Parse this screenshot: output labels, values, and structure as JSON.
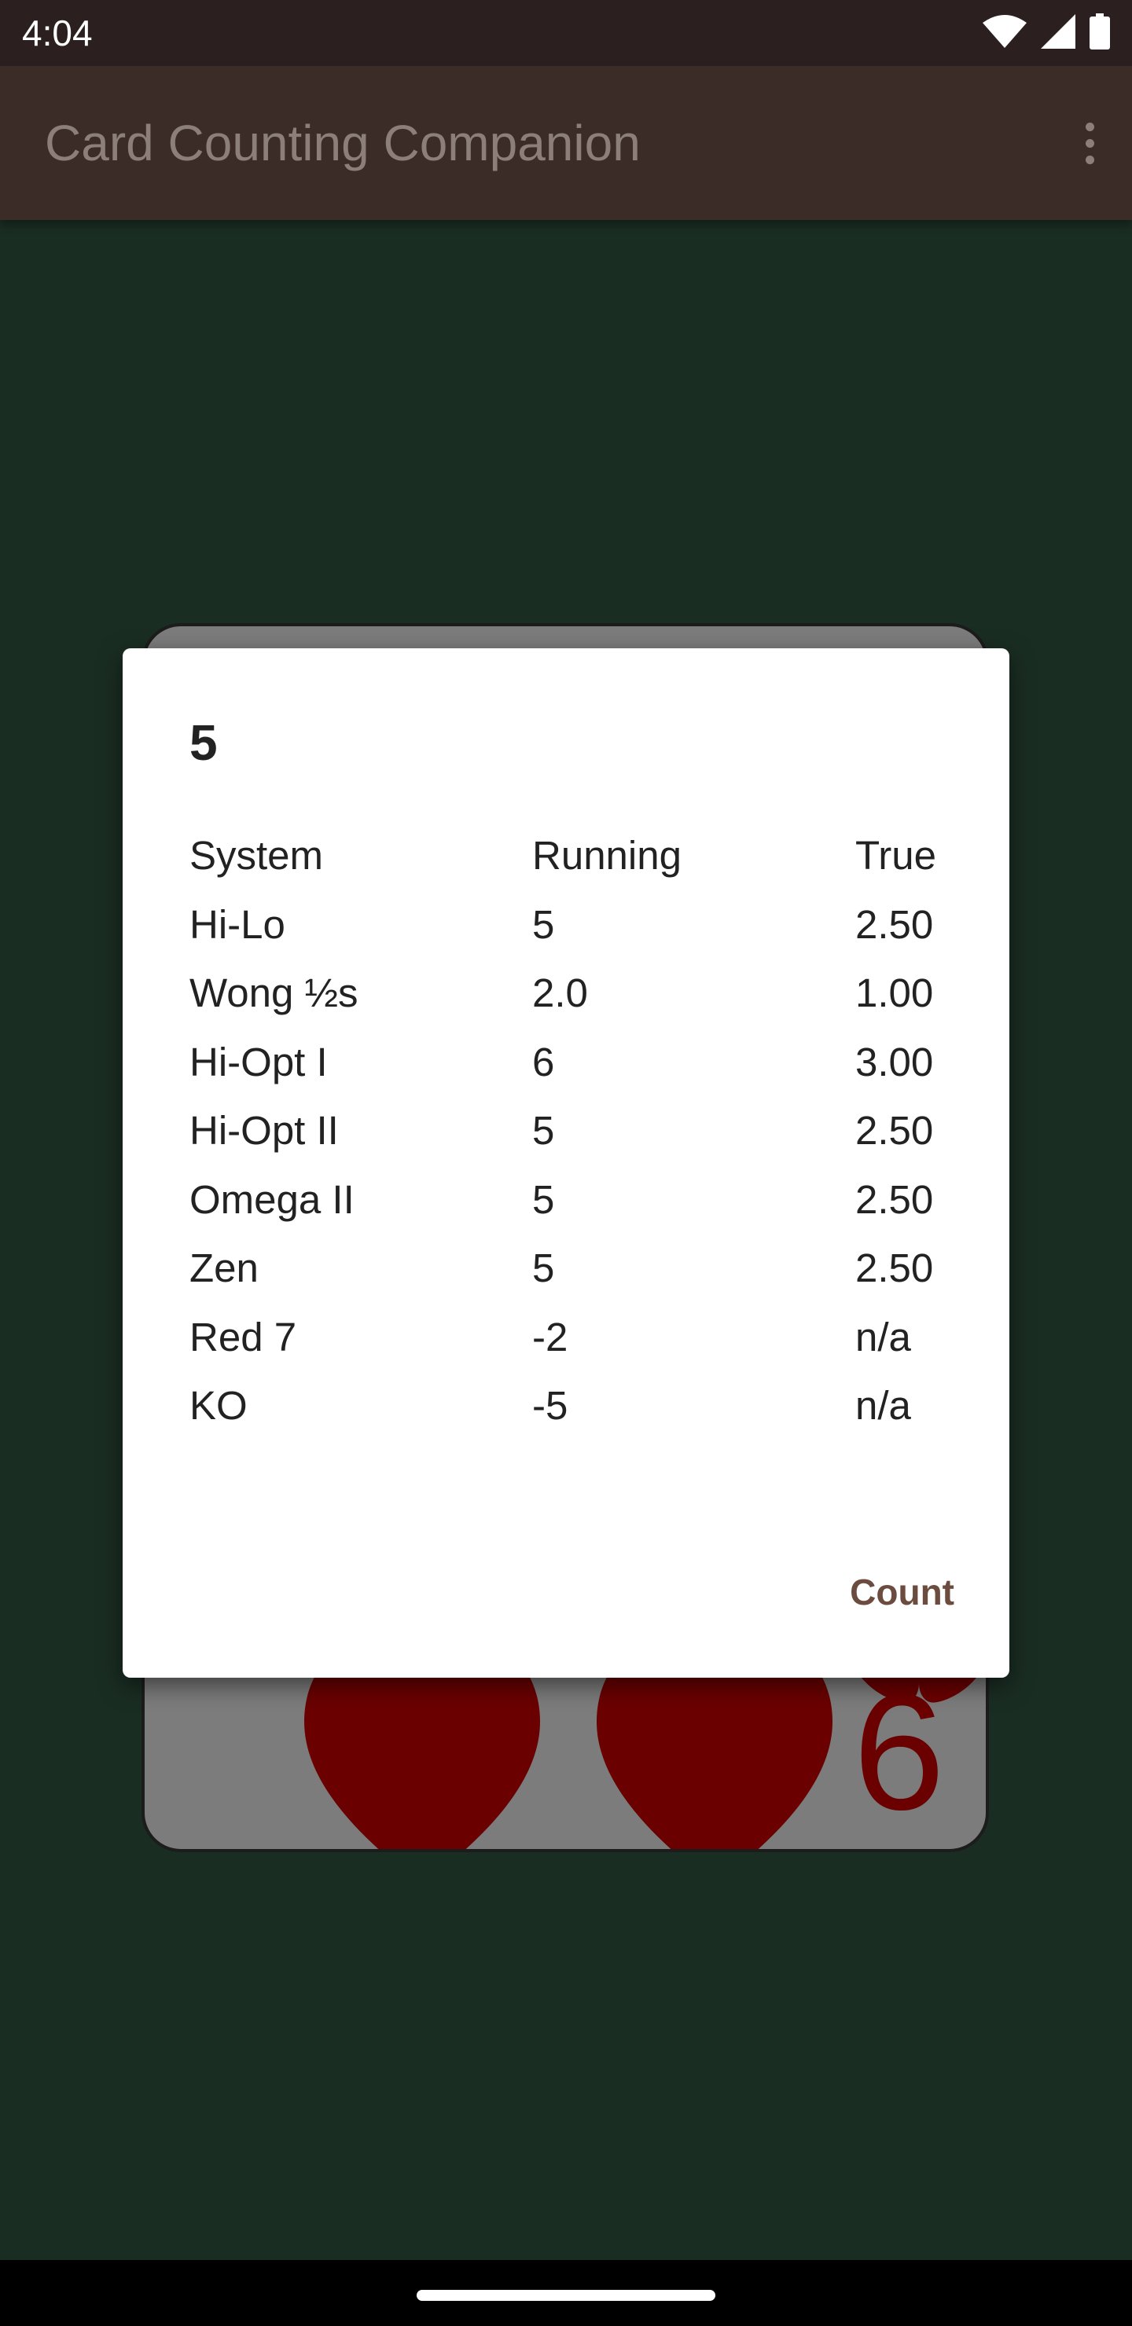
{
  "status_bar": {
    "time": "4:04",
    "icons": [
      "wifi-icon",
      "signal-icon",
      "battery-icon"
    ]
  },
  "app_bar": {
    "title": "Card Counting Companion",
    "menu_icon": "overflow-menu-icon"
  },
  "card": {
    "rank": "6",
    "suit": "hearts",
    "suit_color": "#6b0000"
  },
  "dialog": {
    "title": "5",
    "headers": {
      "system": "System",
      "running": "Running",
      "true": "True"
    },
    "rows": [
      {
        "system": "Hi-Lo",
        "running": "5",
        "true": "2.50"
      },
      {
        "system": "Wong ½s",
        "running": "2.0",
        "true": "1.00"
      },
      {
        "system": "Hi-Opt I",
        "running": "6",
        "true": "3.00"
      },
      {
        "system": "Hi-Opt II",
        "running": "5",
        "true": "2.50"
      },
      {
        "system": "Omega II",
        "running": "5",
        "true": "2.50"
      },
      {
        "system": "Zen",
        "running": "5",
        "true": "2.50"
      },
      {
        "system": "Red 7",
        "running": "-2",
        "true": "n/a"
      },
      {
        "system": "KO",
        "running": "-5",
        "true": "n/a"
      }
    ],
    "button_label": "Count"
  },
  "colors": {
    "background": "#1a2d23",
    "app_bar": "#3b2c28",
    "accent": "#6b4c3f"
  }
}
